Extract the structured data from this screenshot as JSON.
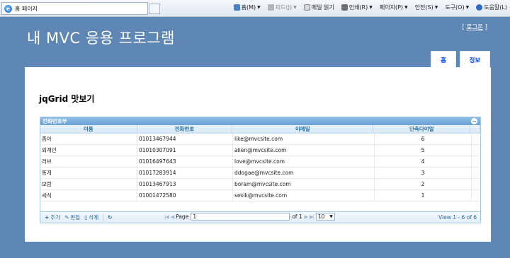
{
  "browser": {
    "tab_title": "홈 페이지",
    "commands": [
      {
        "label": "홈(M)",
        "icon": "home-icon",
        "enabled": true
      },
      {
        "label": "피드(J)",
        "icon": "feed-icon",
        "enabled": false
      },
      {
        "label": "메일 읽기",
        "icon": "mail-icon",
        "enabled": true
      },
      {
        "label": "인쇄(R)",
        "icon": "print-icon",
        "enabled": true
      },
      {
        "label": "페이지(P)",
        "icon": "page-icon",
        "enabled": true
      },
      {
        "label": "안전(S)",
        "icon": "safety-icon",
        "enabled": true
      },
      {
        "label": "도구(O)",
        "icon": "tools-icon",
        "enabled": true
      },
      {
        "label": "도움말(L)",
        "icon": "help-icon",
        "enabled": true
      }
    ]
  },
  "site": {
    "title": "내 MVC 응용 프로그램",
    "login_open": "[",
    "login_label": "로그온",
    "login_close": "]",
    "tabs": [
      "홈",
      "정보"
    ]
  },
  "page": {
    "heading": "jqGrid 맛보기"
  },
  "grid": {
    "caption": "전화번호부",
    "columns": [
      "이름",
      "전화번호",
      "이메일",
      "단축다이얼"
    ],
    "rows": [
      [
        "좀아",
        "01013467944",
        "like@mvcsite.com",
        "6"
      ],
      [
        "외계인",
        "01010307091",
        "alien@mvcsite.com",
        "5"
      ],
      [
        "러브",
        "01016497643",
        "love@mvcsite.com",
        "4"
      ],
      [
        "똥개",
        "01017283914",
        "ddogae@mvcsite.com",
        "3"
      ],
      [
        "보람",
        "01013467913",
        "boram@mvcsite.com",
        "2"
      ],
      [
        "세식",
        "01001472580",
        "sesik@mvcsite.com",
        "1"
      ]
    ],
    "pager": {
      "add_label": "추가",
      "edit_label": "편집",
      "delete_label": "삭제",
      "page_label": "Page",
      "page_value": "1",
      "of_label": "of 1",
      "rows_per_page": "10",
      "view_info": "View 1 - 6 of 6"
    }
  },
  "colors": {
    "background": "#5f87b5",
    "grid_header_text": "#2e6e9e",
    "tab_text": "#034af3"
  }
}
